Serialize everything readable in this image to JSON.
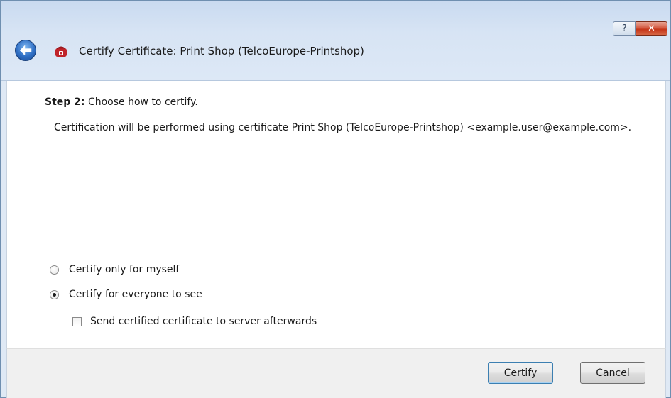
{
  "window": {
    "title": "Certify Certificate: Print Shop (TelcoEurope-Printshop)",
    "help_button": "?",
    "close_button": "✕"
  },
  "content": {
    "step_label": "Step 2:",
    "step_text": " Choose how to certify.",
    "info": "Certification will be performed using certificate Print Shop (TelcoEurope-Printshop) <example.user@example.com>.",
    "options": {
      "myself": {
        "label": "Certify only for myself",
        "selected": false
      },
      "everyone": {
        "label": "Certify for everyone to see",
        "selected": true
      },
      "send_to_server": {
        "label": "Send certified certificate to server afterwards",
        "checked": false
      }
    }
  },
  "footer": {
    "certify_label": "Certify",
    "cancel_label": "Cancel"
  },
  "icons": {
    "back": "back-arrow-icon",
    "app": "certificate-icon",
    "help": "help-icon",
    "close": "close-icon"
  },
  "colors": {
    "frame": "#d7e4f4",
    "close_button": "#c53619",
    "back_button": "#2f6fc4",
    "app_icon": "#c0242a"
  }
}
